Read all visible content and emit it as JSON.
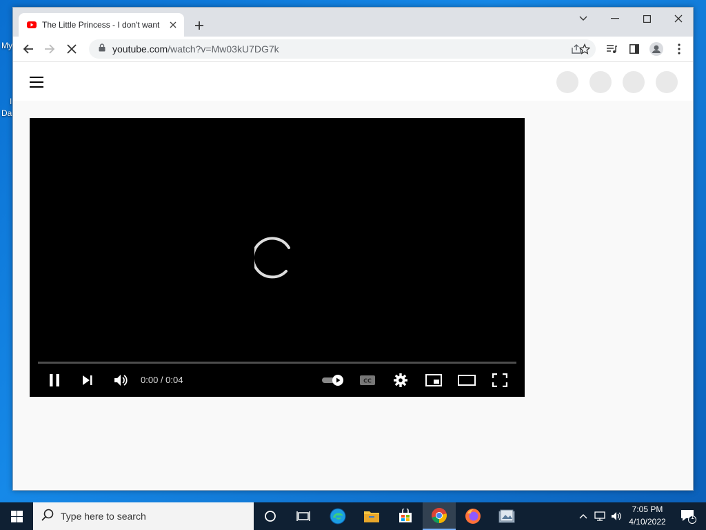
{
  "desktop": {
    "icon_label_1": "My",
    "icon_label_2": "Da",
    "icon_label_3": "I"
  },
  "browser": {
    "tab_title": "The Little Princess - I don't want",
    "url_host": "youtube.com",
    "url_path": "/watch?v=Mw03kU7DG7k"
  },
  "player": {
    "time": "0:00 / 0:04",
    "progress_fraction": 0.0
  },
  "taskbar": {
    "search_placeholder": "Type here to search",
    "clock_time": "7:05 PM",
    "clock_date": "4/10/2022",
    "notification_count": "1"
  },
  "colors": {
    "taskbar_bg": "#0f2033",
    "youtube_red": "#ff0000",
    "player_bg": "#000000"
  }
}
